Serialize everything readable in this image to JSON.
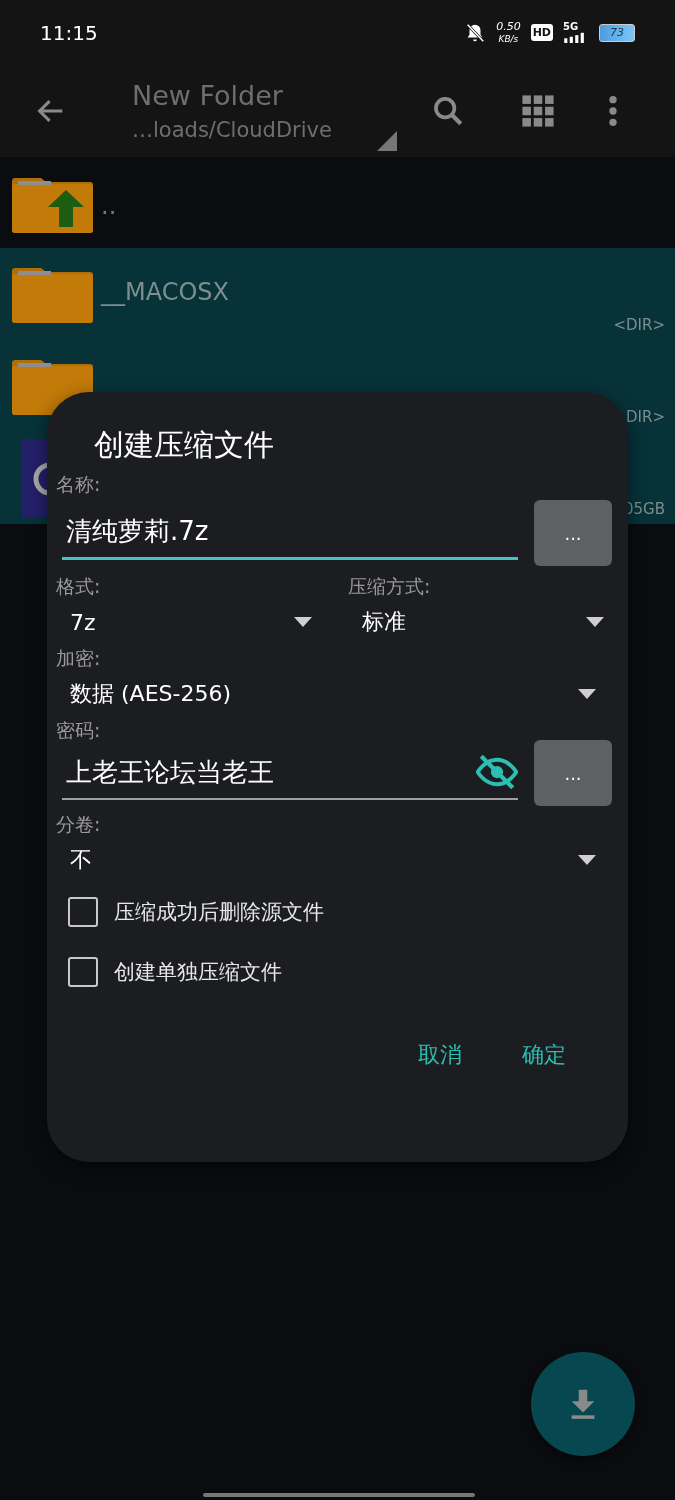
{
  "status_bar": {
    "time": "11:15",
    "net_speed": "0.50",
    "net_unit": "KB/s",
    "hd": "HD",
    "network": "5G",
    "battery": "73"
  },
  "toolbar": {
    "title": "New Folder",
    "path": "…loads/CloudDrive"
  },
  "files": [
    {
      "kind": "parent",
      "name": "..",
      "selected": false
    },
    {
      "kind": "folder",
      "name": "__MACOSX",
      "size": "<DIR>",
      "selected": true
    },
    {
      "kind": "folder",
      "size": "DIR>",
      "selected": true
    },
    {
      "kind": "file",
      "size": "05GB",
      "selected": true
    }
  ],
  "dialog": {
    "title": "创建压缩文件",
    "name_label": "名称:",
    "name_value": "清纯萝莉.7z",
    "name_button": "...",
    "format_label": "格式:",
    "format_value": "7z",
    "method_label": "压缩方式:",
    "method_value": "标准",
    "encryption_label": "加密:",
    "encryption_value": "数据 (AES-256)",
    "password_label": "密码:",
    "password_value": "上老王论坛当老王",
    "password_visible": true,
    "password_button": "...",
    "split_label": "分卷:",
    "split_value": "不",
    "options": [
      {
        "label": "压缩成功后删除源文件",
        "checked": false
      },
      {
        "label": "创建单独压缩文件",
        "checked": false
      }
    ],
    "buttons": [
      "取消",
      "确定"
    ]
  }
}
